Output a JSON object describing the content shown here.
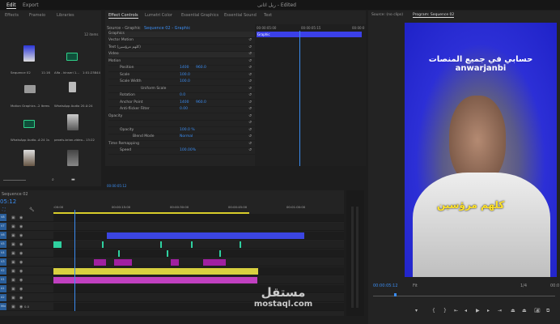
{
  "menu": {
    "edit": "Edit",
    "export": "Export",
    "title": "ريل اثانى - Edited"
  },
  "project": {
    "tabs": [
      "Effects",
      "Frameio",
      "Libraries"
    ],
    "count": "12 items",
    "items": [
      {
        "name": "Sequence 02",
        "meta": "11:16"
      },
      {
        "name": "Alfa - kinseri 1...",
        "meta": "1:01:23844"
      },
      {
        "name": "Motion Graphics ...",
        "meta": "2 Items"
      },
      {
        "name": "WhatsApp Audio 20...",
        "meta": "0:24"
      },
      {
        "name": "WhatsApp Audio...",
        "meta": "4:24 1s"
      },
      {
        "name": "pexels-brian-video...",
        "meta": "13:22"
      }
    ]
  },
  "effects": {
    "tabs": [
      "Effect Controls",
      "Lumetri Color",
      "Essential Graphics",
      "Essential Sound",
      "Text"
    ],
    "source": "Source - Graphic",
    "sequence": "Sequence 02 - Graphic",
    "section_graphics": "Graphics",
    "rows": [
      {
        "label": "Vector Motion",
        "v1": "",
        "v2": ""
      },
      {
        "label": "Text (كلهم مرؤسين)",
        "v1": "",
        "v2": ""
      },
      {
        "label": "Video",
        "v1": "",
        "v2": ""
      },
      {
        "label": "Motion",
        "v1": "",
        "v2": ""
      },
      {
        "label": "Position",
        "v1": "1400",
        "v2": "960.0"
      },
      {
        "label": "Scale",
        "v1": "100.0",
        "v2": ""
      },
      {
        "label": "Scale Width",
        "v1": "100.0",
        "v2": ""
      },
      {
        "label": "Uniform Scale",
        "v1": "",
        "v2": ""
      },
      {
        "label": "Rotation",
        "v1": "0.0",
        "v2": ""
      },
      {
        "label": "Anchor Point",
        "v1": "1400",
        "v2": "960.0"
      },
      {
        "label": "Anti-flicker Filter",
        "v1": "0.00",
        "v2": ""
      },
      {
        "label": "Opacity",
        "v1": "",
        "v2": ""
      },
      {
        "label": "",
        "v1": "",
        "v2": ""
      },
      {
        "label": "Opacity",
        "v1": "100.0 %",
        "v2": ""
      },
      {
        "label": "Blend Mode",
        "v1": "Normal",
        "v2": ""
      },
      {
        "label": "Time Remapping",
        "v1": "",
        "v2": ""
      },
      {
        "label": "Speed",
        "v1": "100.00%",
        "v2": ""
      }
    ],
    "mini_times": [
      "00:00:05:00",
      "00:00:05:15",
      "00:00:0"
    ],
    "clip_label": "Graphic",
    "timecode": "00:00:05:12"
  },
  "timeline": {
    "seq": "Sequence 02",
    "timecode": "05:12",
    "ruler": [
      ":00:00",
      "00:00:15:00",
      "00:00:30:00",
      "00:00:45:00",
      "00:01:00:00"
    ],
    "tracks": [
      "V8",
      "V7",
      "V6",
      "V5",
      "V4",
      "V3",
      "V2",
      "V1",
      "A1",
      "A2",
      "Mix"
    ],
    "mix_val": "0.0"
  },
  "program": {
    "source_tab": "Source: (no clips)",
    "program_tab": "Program: Sequence 02",
    "caption_top": "حسابي في جميع المنصات anwarjanbi",
    "caption_mid": "كلهم مرؤسين",
    "timecode": "00:00:05:12",
    "fit": "Fit",
    "quality": "1/4",
    "end": "00:0"
  },
  "watermark": {
    "ar": "مستقل",
    "en": "mostaql.com"
  }
}
